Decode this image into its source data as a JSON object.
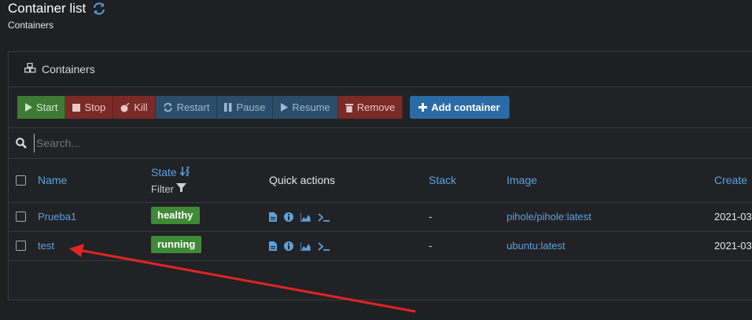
{
  "header": {
    "title": "Container list",
    "subtitle": "Containers"
  },
  "panel": {
    "title": "Containers"
  },
  "toolbar": {
    "start": "Start",
    "stop": "Stop",
    "kill": "Kill",
    "restart": "Restart",
    "pause": "Pause",
    "resume": "Resume",
    "remove": "Remove",
    "add": "Add container"
  },
  "search": {
    "placeholder": "Search..."
  },
  "table": {
    "headers": {
      "name": "Name",
      "state": "State",
      "filter": "Filter",
      "quick_actions": "Quick actions",
      "stack": "Stack",
      "image": "Image",
      "created": "Create"
    },
    "rows": [
      {
        "name": "Prueba1",
        "state": "healthy",
        "stack": "-",
        "image": "pihole/pihole:latest",
        "created": "2021-03"
      },
      {
        "name": "test",
        "state": "running",
        "stack": "-",
        "image": "ubuntu:latest",
        "created": "2021-03"
      }
    ]
  },
  "colors": {
    "accent": "#5aa3e0",
    "success": "#3e8a35",
    "danger": "#7a2a27",
    "annotation_arrow": "#e02424"
  }
}
